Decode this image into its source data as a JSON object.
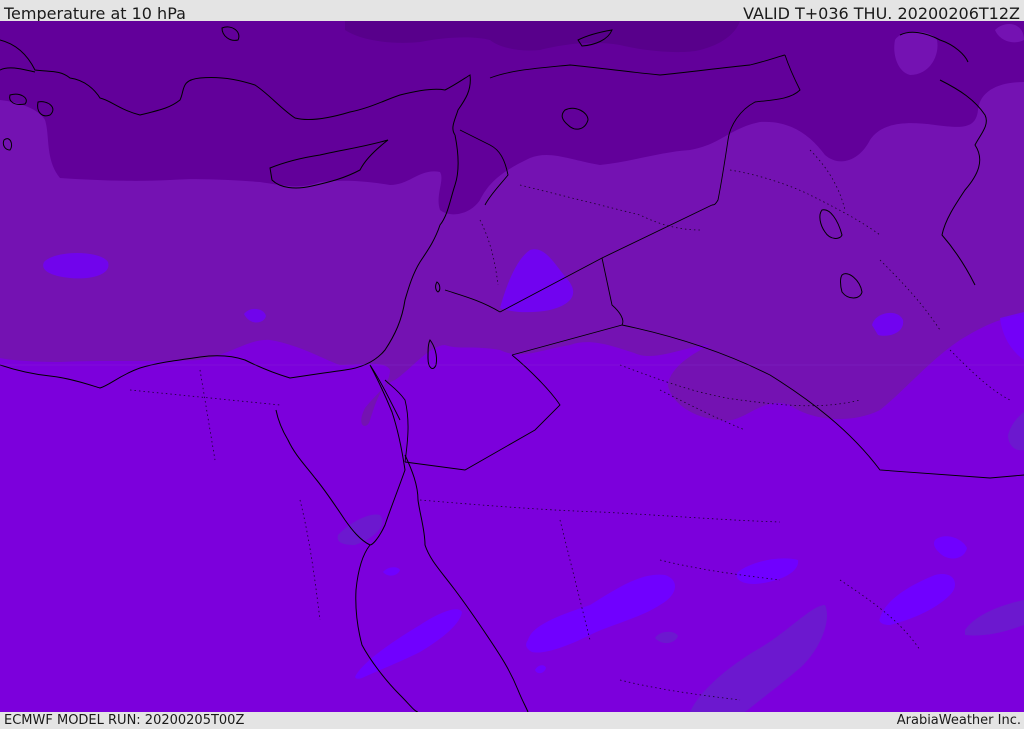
{
  "header": {
    "title": "Temperature at 10 hPa",
    "valid_time": "VALID T+036 THU. 20200206T12Z"
  },
  "footer": {
    "model_run": "ECMWF MODEL RUN: 20200205T00Z",
    "credit": "ArabiaWeather Inc."
  },
  "map": {
    "fill_colors": {
      "coldest": "#62009a",
      "cold": "#7412b2",
      "mild": "#7c00dc",
      "warm": "#7000ff",
      "warm_patch": "#6a1ccd"
    },
    "boundary_color": "#000000"
  }
}
